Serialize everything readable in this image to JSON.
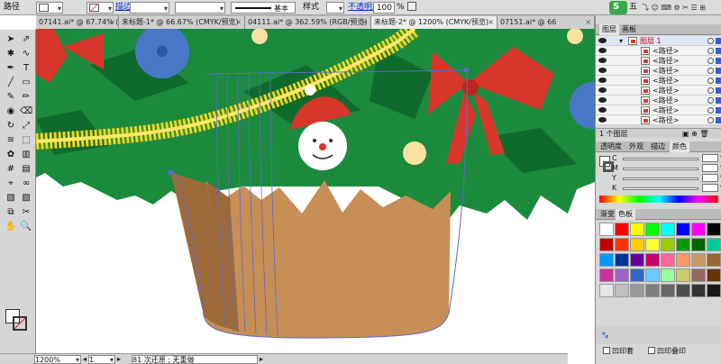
{
  "control_bar": {
    "selection_label": "路径",
    "stroke_label": "描边",
    "stroke_style": "基本",
    "style_label": "样式",
    "opacity_link": "不透明度",
    "opacity_value": "100",
    "opacity_unit": "%",
    "brand_glyphs": "五"
  },
  "tabs": [
    {
      "label": "07141.ai* @ 67.74% (RGB/预览)",
      "active": false
    },
    {
      "label": "未标题-1* @ 66.67% (CMYK/预览)",
      "active": false
    },
    {
      "label": "04111.ai* @ 362.59% (RGB/预览)",
      "active": false
    },
    {
      "label": "未标题-2* @ 1200% (CMYK/预览)",
      "active": true
    },
    {
      "label": "07151.ai* @ 66",
      "active": false
    }
  ],
  "tools": [
    "selection",
    "direct-selection",
    "magic-wand",
    "lasso",
    "pen",
    "type",
    "line",
    "rectangle",
    "paintbrush",
    "pencil",
    "blob-brush",
    "eraser",
    "rotate",
    "scale",
    "warp",
    "free-transform",
    "symbol-sprayer",
    "column-graph",
    "mesh",
    "gradient",
    "eyedropper",
    "blend",
    "live-paint",
    "live-paint-select",
    "slice",
    "scissors",
    "hand",
    "zoom"
  ],
  "status": {
    "zoom": "1200%",
    "page": "1",
    "message": "81 次还原 ; 无重做"
  },
  "layers_panel": {
    "tabs": [
      "图层",
      "画板"
    ],
    "layer_name": "图层 1",
    "items": [
      "<路径>",
      "<路径>",
      "<路径>",
      "<路径>",
      "<路径>",
      "<路径>",
      "<路径>",
      "<路径>"
    ],
    "footer": "1 个图层"
  },
  "color_panel": {
    "tabs": [
      "透明度",
      "外观",
      "描边",
      "颜色"
    ],
    "channels": [
      "C",
      "M",
      "Y",
      "K"
    ],
    "units": [
      "%",
      "%",
      "%",
      "%"
    ]
  },
  "swatches_panel": {
    "tabs": [
      "渐变",
      "色板"
    ],
    "colors": [
      "#ffffff",
      "#ff0000",
      "#ffff00",
      "#00ff00",
      "#00ffff",
      "#0000ff",
      "#ff00ff",
      "#000000",
      "#c00000",
      "#ff3300",
      "#ffcc00",
      "#ffff33",
      "#99cc00",
      "#009900",
      "#006600",
      "#00cc99",
      "#0099ff",
      "#003399",
      "#660099",
      "#cc0066",
      "#ff6699",
      "#ff9966",
      "#cc9966",
      "#996633",
      "#cc3399",
      "#9966cc",
      "#3366cc",
      "#66ccff",
      "#99ff99",
      "#cccc66",
      "#996666",
      "#663300",
      "#e6e6e6",
      "#bfbfbf",
      "#999999",
      "#7f7f7f",
      "#666666",
      "#4d4d4d",
      "#333333",
      "#1a1a1a"
    ],
    "footer_left": "凹印套",
    "footer_right": "凹印叠印"
  },
  "accent": "#2f62d4",
  "selection_path_color": "#5b6ad0",
  "scene_colors": {
    "tree_green": "#1c8a3c",
    "tree_dark": "#0f6a2d",
    "basket": "#c78e55",
    "basket_dark": "#9e6a39",
    "garland": "#f2d21e",
    "bow": "#d8352a",
    "flower": "#4a78c8",
    "snow": "#ffffff"
  }
}
